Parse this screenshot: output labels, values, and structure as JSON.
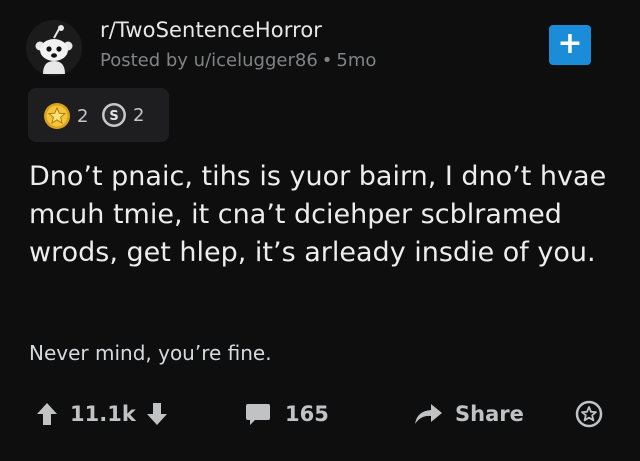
{
  "header": {
    "subreddit": "r/TwoSentenceHorror",
    "posted_by": "Posted by u/icelugger86",
    "age": "5mo",
    "join_symbol": "+"
  },
  "awards": [
    {
      "icon": "gold-star-award-icon",
      "count": "2"
    },
    {
      "icon": "silver-award-icon",
      "count": "2"
    }
  ],
  "post": {
    "title": "Dno’t pnaic, tihs is yuor bairn, I dno’t hvae mcuh tmie, it cna’t dciehper scblramed wrods, get hlep, it’s arleady insdie of you.",
    "body": "Never mind, you’re fine."
  },
  "actions": {
    "votes": "11.1k",
    "comments": "165",
    "share": "Share"
  },
  "colors": {
    "background": "#0e0e0f",
    "join_button": "#1a8cd8",
    "text": "#d7dadc",
    "muted": "#818384"
  }
}
